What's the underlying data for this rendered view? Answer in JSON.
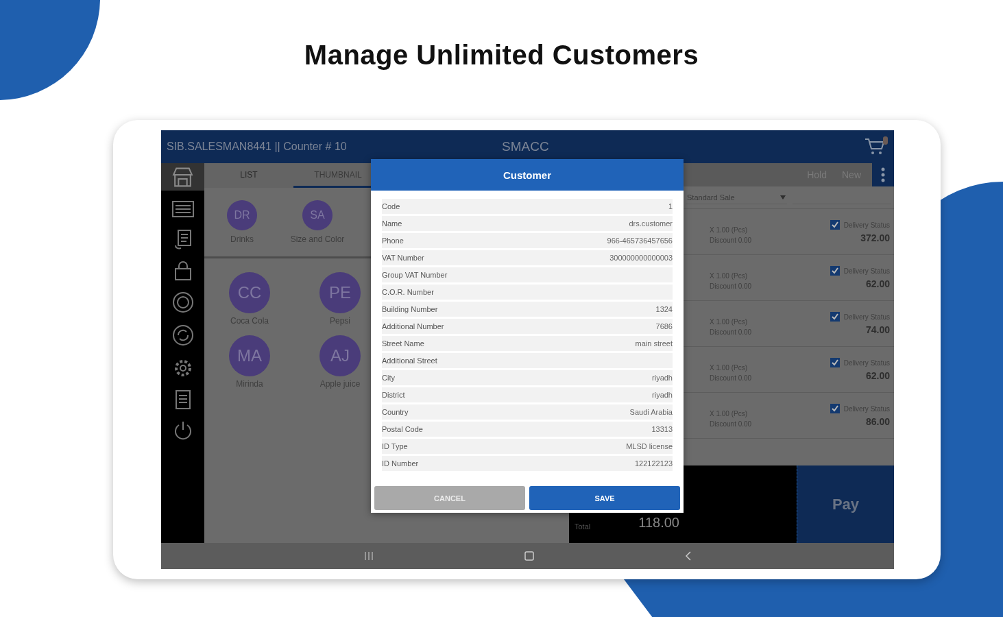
{
  "headline": "Manage Unlimited Customers",
  "app_bar": {
    "user_counter": "SIB.SALESMAN8441 || Counter  # 10",
    "title": "SMACC"
  },
  "tabs": [
    {
      "label": "LIST",
      "selected": false
    },
    {
      "label": "THUMBNAIL",
      "selected": true
    }
  ],
  "categories": [
    {
      "initials": "DR",
      "label": "Drinks"
    },
    {
      "initials": "SA",
      "label": "Size and Color"
    }
  ],
  "products": [
    {
      "initials": "CC",
      "label": "Coca Cola"
    },
    {
      "initials": "PE",
      "label": "Pepsi"
    },
    {
      "initials": "MA",
      "label": "Mirinda"
    },
    {
      "initials": "AJ",
      "label": "Apple juice"
    }
  ],
  "toolbar": {
    "hold": "Hold",
    "new": "New"
  },
  "sale_type": "Standard Sale",
  "cart": [
    {
      "quantity": "X 1.00 (Pcs)",
      "discount": "Discount 0.00",
      "status_label": "Delivery Status",
      "checked": true,
      "amount": "372.00"
    },
    {
      "quantity": "X 1.00 (Pcs)",
      "discount": "Discount 0.00",
      "status_label": "Delivery Status",
      "checked": true,
      "amount": "62.00"
    },
    {
      "quantity": "X 1.00 (Pcs)",
      "discount": "Discount 0.00",
      "status_label": "Delivery Status",
      "checked": true,
      "amount": "74.00"
    },
    {
      "quantity": "X 1.00 (Pcs)",
      "discount": "Discount 0.00",
      "status_label": "Delivery Status",
      "checked": true,
      "amount": "62.00"
    },
    {
      "quantity": "X 1.00 (Pcs)",
      "discount": "Discount 0.00",
      "status_label": "Delivery Status",
      "checked": true,
      "amount": "86.00"
    }
  ],
  "total": {
    "label": "Total",
    "value": "118.00"
  },
  "pay_button": "Pay",
  "dialog": {
    "title": "Customer",
    "fields": [
      {
        "label": "Code",
        "value": "1"
      },
      {
        "label": "Name",
        "value": "drs.customer"
      },
      {
        "label": "Phone",
        "value": "966-465736457656"
      },
      {
        "label": "VAT Number",
        "value": "300000000000003"
      },
      {
        "label": "Group VAT Number"
      },
      {
        "label": "C.O.R. Number"
      },
      {
        "label": "Building Number",
        "value": "1324"
      },
      {
        "label": "Additional Number",
        "value": "7686"
      },
      {
        "label": "Street Name",
        "value": "main street"
      },
      {
        "label": "Additional Street"
      },
      {
        "label": "City",
        "value": "riyadh"
      },
      {
        "label": "District",
        "value": "riyadh"
      },
      {
        "label": "Country",
        "value": "Saudi Arabia"
      },
      {
        "label": "Postal Code",
        "value": "13313"
      },
      {
        "label": "ID Type",
        "value": "MLSD license"
      },
      {
        "label": "ID Number",
        "value": "122122123"
      }
    ],
    "cancel": "CANCEL",
    "save": "SAVE"
  }
}
